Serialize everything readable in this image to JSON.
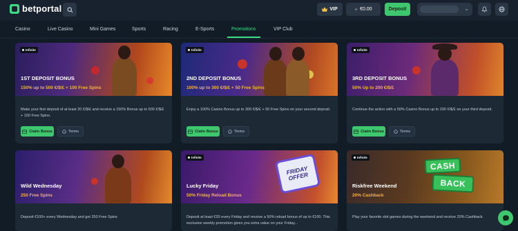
{
  "header": {
    "logo_text": "betportal",
    "vip_label": "VIP",
    "balance": "€0.00",
    "deposit_label": "Deposit"
  },
  "nav": {
    "items": [
      "Casino",
      "Live Casino",
      "Mini Games",
      "Sports",
      "Racing",
      "E-Sports",
      "Promotions",
      "VIP Club"
    ],
    "active": "Promotions"
  },
  "promotions": [
    {
      "tag": "Infinite",
      "title": "1ST DEPOSIT BONUS",
      "subtitle": "150% up to 500 €/$/£ + 100 Free Spins",
      "description": "Make your first deposit of at least 20 €/$/£ and receive a 150% Bonus up to 500 €/$/£ + 100 Free Spins.",
      "claim_label": "Claim Bonus",
      "terms_label": "Terms"
    },
    {
      "tag": "Infinite",
      "title": "2ND DEPOSIT BONUS",
      "subtitle": "100% up to 300 €/$/£ + 50 Free Spins",
      "description": "Enjoy a 100% Casino Bonus up to 300 €/$/£ + 50 Free Spins on your second deposit.",
      "claim_label": "Claim Bonus",
      "terms_label": "Terms"
    },
    {
      "tag": "Infinite",
      "title": "3RD DEPOSIT BONUS",
      "subtitle": "50% Up to 200 €/$/£",
      "description": "Continue the action with a 50% Casino Bonus up to 200 €/$/£ on your third deposit.",
      "claim_label": "Claim Bonus",
      "terms_label": "Terms"
    },
    {
      "tag": "Infinite",
      "title": "Wild Wednesday",
      "subtitle": "250 Free Spins",
      "description": "Deposit €100+ every Wednesday and get 250 Free Spins"
    },
    {
      "tag": "Infinite",
      "title": "Lucky Friday",
      "subtitle": "50% Friday Reload Bonus",
      "description": "Deposit at least €20 every Friday and receive a 50% reload bonus of up to €100. This exclusive weekly promotion gives you extra value on your Friday...",
      "art_line1": "FRIDAY",
      "art_line2": "OFFER"
    },
    {
      "tag": "Infinite",
      "title": "Riskfree Weekend",
      "subtitle": "20% Cashback",
      "description": "Play your favorite slot games during the weekend and receive 20% Cashback.",
      "art_line1": "CASH",
      "art_line2": "BACK"
    }
  ],
  "colors": {
    "accent_green": "#3ec76e",
    "subtitle_orange": "#f6b44a",
    "background": "#121c27",
    "card": "#1d2935"
  },
  "icons": {
    "logo": "betportal-logo-icon",
    "search": "search-icon",
    "vip": "crown-icon",
    "balance": "plus-icon",
    "account_dropdown": "chevron-down-icon",
    "notifications": "bell-icon",
    "language": "globe-icon",
    "claim": "gift-icon",
    "terms": "info-icon",
    "chat": "chat-icon"
  }
}
